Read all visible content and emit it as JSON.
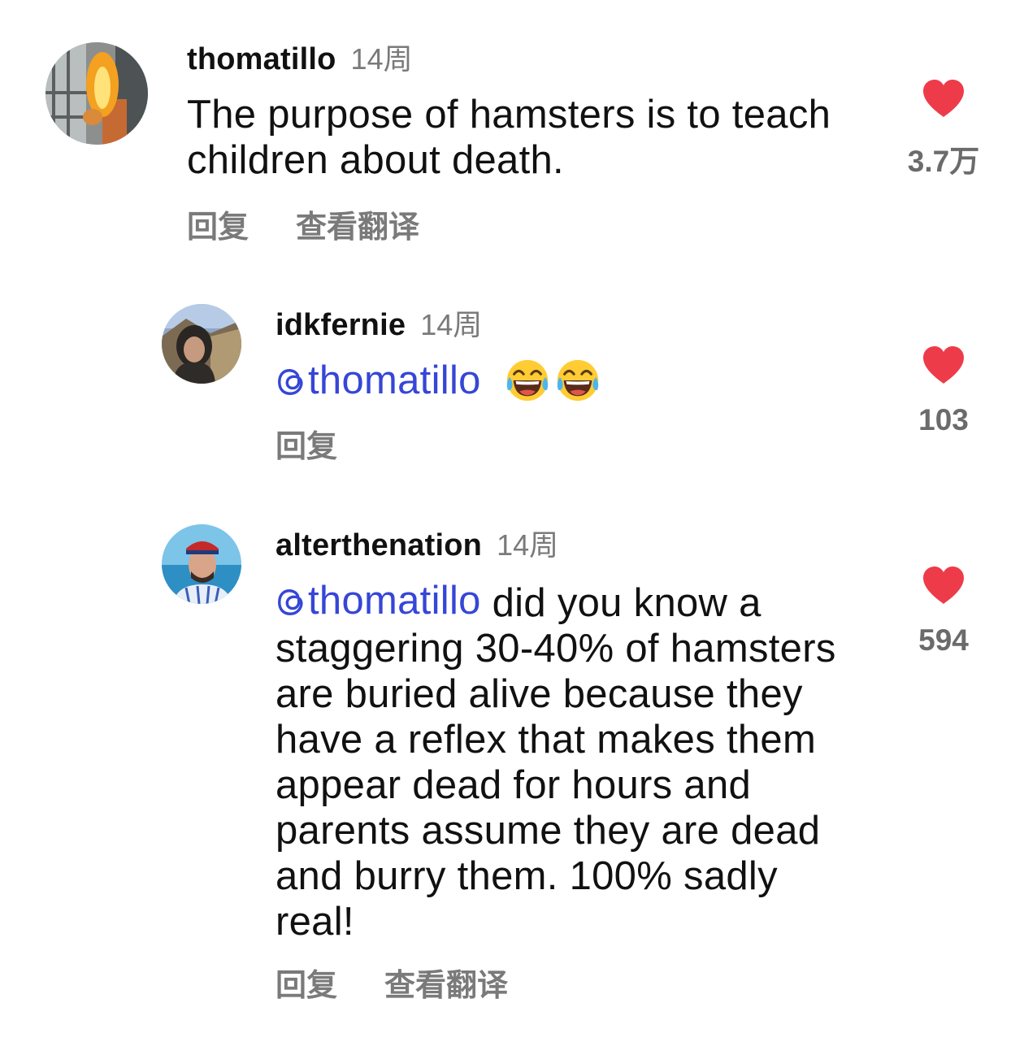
{
  "accent_colors": {
    "mention": "#3646d6",
    "heart": "#ee3b4a",
    "secondary_text": "#7a7a7a"
  },
  "comments": [
    {
      "username": "thomatillo",
      "time": "14周",
      "text": "The purpose of hamsters is to teach children about death.",
      "actions": {
        "reply": "回复",
        "translate": "查看翻译"
      },
      "likes": "3.7万"
    }
  ],
  "replies": [
    {
      "username": "idkfernie",
      "time": "14周",
      "mention": "thomatillo",
      "emojis": [
        "face-with-tears-of-joy",
        "face-with-tears-of-joy"
      ],
      "actions": {
        "reply": "回复"
      },
      "likes": "103"
    },
    {
      "username": "alterthenation",
      "time": "14周",
      "mention": "thomatillo",
      "text_lines": [
        " did you know a",
        "staggering 30-40% of hamsters",
        "are buried alive because they",
        "have a reflex that makes them",
        "appear dead for hours and",
        "parents assume they are dead",
        "and burry them. 100% sadly",
        "real!"
      ],
      "actions": {
        "reply": "回复",
        "translate": "查看翻译"
      },
      "likes": "594"
    }
  ]
}
